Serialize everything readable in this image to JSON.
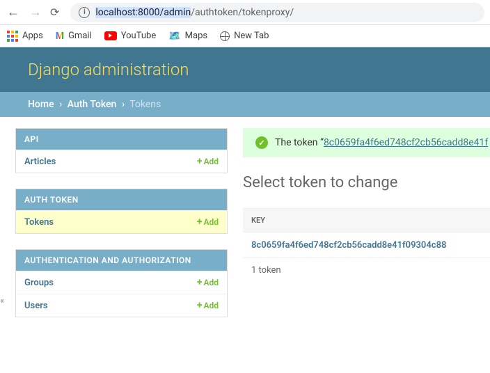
{
  "browser": {
    "url_host": "localhost:8000/admin",
    "url_path": "/authtoken/tokenproxy/",
    "bookmarks": {
      "apps": "Apps",
      "gmail": "Gmail",
      "youtube": "YouTube",
      "maps": "Maps",
      "newtab": "New Tab"
    }
  },
  "header": {
    "title": "Django administration"
  },
  "breadcrumbs": {
    "home": "Home",
    "app": "Auth Token",
    "current": "Tokens"
  },
  "sidebar": {
    "apps": [
      {
        "caption": "API",
        "models": [
          {
            "name": "Articles",
            "add": "Add",
            "selected": false
          }
        ]
      },
      {
        "caption": "AUTH TOKEN",
        "models": [
          {
            "name": "Tokens",
            "add": "Add",
            "selected": true
          }
        ]
      },
      {
        "caption": "AUTHENTICATION AND AUTHORIZATION",
        "models": [
          {
            "name": "Groups",
            "add": "Add",
            "selected": false
          },
          {
            "name": "Users",
            "add": "Add",
            "selected": false
          }
        ]
      }
    ]
  },
  "message": {
    "prefix": "The token “",
    "token_link": "8c0659fa4f6ed748cf2cb56cadd8e41f"
  },
  "main": {
    "title": "Select token to change",
    "column_header": "KEY",
    "rows": [
      {
        "key": "8c0659fa4f6ed748cf2cb56cadd8e41f09304c88"
      }
    ],
    "paginator": "1 token"
  },
  "colors": {
    "header_bg": "#417690",
    "accent": "#79aec8",
    "title": "#f5dd5d",
    "link": "#417690",
    "add": "#70bf2b",
    "highlight": "#ffffcc"
  }
}
